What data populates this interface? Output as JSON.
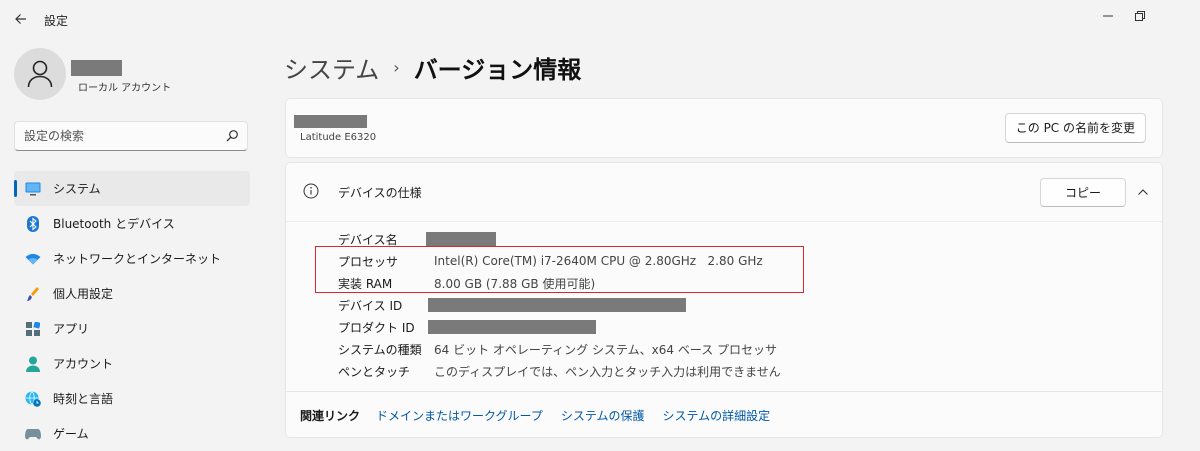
{
  "window": {
    "title": "設定"
  },
  "user": {
    "account_type": "ローカル アカウント"
  },
  "search": {
    "placeholder": "設定の検索"
  },
  "sidebar": {
    "items": [
      {
        "label": "システム",
        "icon": "monitor-icon",
        "active": true
      },
      {
        "label": "Bluetooth とデバイス",
        "icon": "bluetooth-icon"
      },
      {
        "label": "ネットワークとインターネット",
        "icon": "wifi-icon"
      },
      {
        "label": "個人用設定",
        "icon": "paintbrush-icon"
      },
      {
        "label": "アプリ",
        "icon": "apps-icon"
      },
      {
        "label": "アカウント",
        "icon": "person-icon"
      },
      {
        "label": "時刻と言語",
        "icon": "globe-clock-icon"
      },
      {
        "label": "ゲーム",
        "icon": "gamepad-icon"
      }
    ]
  },
  "breadcrumb": {
    "parent": "システム",
    "separator": "›",
    "current": "バージョン情報"
  },
  "device": {
    "model": "Latitude E6320",
    "rename_button": "この PC の名前を変更"
  },
  "specs": {
    "title": "デバイスの仕様",
    "copy_button": "コピー",
    "rows": [
      {
        "label": "デバイス名",
        "value": ""
      },
      {
        "label": "プロセッサ",
        "value": "Intel(R) Core(TM) i7-2640M CPU @ 2.80GHz   2.80 GHz"
      },
      {
        "label": "実装 RAM",
        "value": "8.00 GB (7.88 GB 使用可能)"
      },
      {
        "label": "デバイス ID",
        "value": ""
      },
      {
        "label": "プロダクト ID",
        "value": ""
      },
      {
        "label": "システムの種類",
        "value": "64 ビット オペレーティング システム、x64 ベース プロセッサ"
      },
      {
        "label": "ペンとタッチ",
        "value": "このディスプレイでは、ペン入力とタッチ入力は利用できません"
      }
    ]
  },
  "related_links": {
    "title": "関連リンク",
    "links": [
      "ドメインまたはワークグループ",
      "システムの保護",
      "システムの詳細設定"
    ]
  },
  "colors": {
    "accent": "#0067c0",
    "link": "#0058a8",
    "highlight_border": "#d42a2a",
    "redaction": "#7a7a7a"
  }
}
